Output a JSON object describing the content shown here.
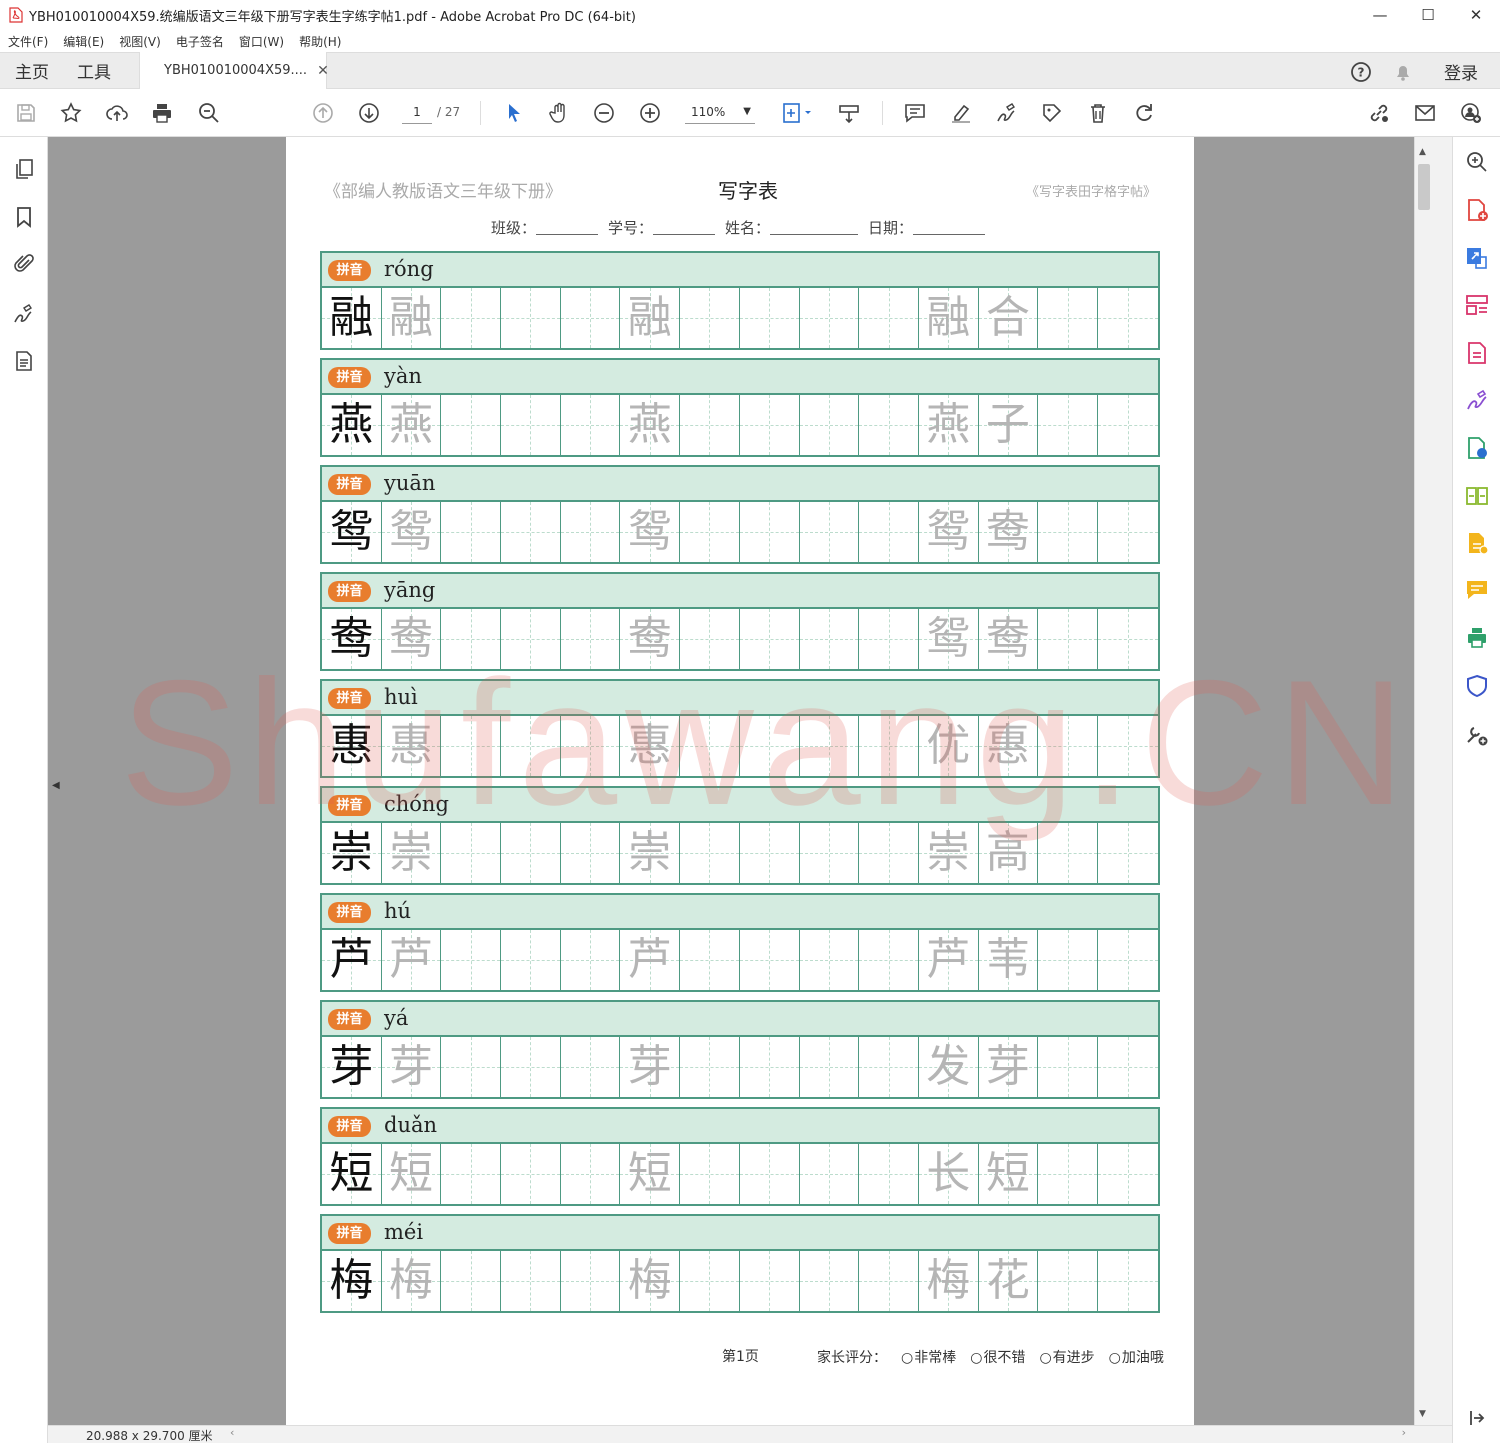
{
  "window": {
    "title": "YBH010010004X59.统编版语文三年级下册写字表生字练字帖1.pdf - Adobe Acrobat Pro DC (64-bit)",
    "minimize": "—",
    "maximize": "☐",
    "close": "✕"
  },
  "menu": [
    "文件(F)",
    "编辑(E)",
    "视图(V)",
    "电子签名",
    "窗口(W)",
    "帮助(H)"
  ],
  "tabs": {
    "home": "主页",
    "tools": "工具",
    "doc": "YBH010010004X59....",
    "doc_close": "✕",
    "login": "登录"
  },
  "toolbar": {
    "page_current": "1",
    "page_total": "/ 27",
    "zoom": "110%"
  },
  "page": {
    "header_left": "《部编人教版语文三年级下册》",
    "header_center": "写字表",
    "header_right": "《写字表田字格字帖》",
    "info": {
      "class_label": "班级：",
      "number_label": "学号：",
      "name_label": "姓名：",
      "date_label": "日期："
    },
    "badge": "拼音",
    "rows": [
      {
        "pinyin": "róng",
        "char": "融",
        "word": [
          "融",
          "合"
        ]
      },
      {
        "pinyin": "yàn",
        "char": "燕",
        "word": [
          "燕",
          "子"
        ]
      },
      {
        "pinyin": "yuān",
        "char": "鸳",
        "word": [
          "鸳",
          "鸯"
        ]
      },
      {
        "pinyin": "yāng",
        "char": "鸯",
        "word": [
          "鸳",
          "鸯"
        ]
      },
      {
        "pinyin": "huì",
        "char": "惠",
        "word": [
          "优",
          "惠"
        ]
      },
      {
        "pinyin": "chóng",
        "char": "崇",
        "word": [
          "崇",
          "高"
        ]
      },
      {
        "pinyin": "hú",
        "char": "芦",
        "word": [
          "芦",
          "苇"
        ]
      },
      {
        "pinyin": "yá",
        "char": "芽",
        "word": [
          "发",
          "芽"
        ]
      },
      {
        "pinyin": "duǎn",
        "char": "短",
        "word": [
          "长",
          "短"
        ]
      },
      {
        "pinyin": "méi",
        "char": "梅",
        "word": [
          "梅",
          "花"
        ]
      }
    ],
    "footer_page": "第1页",
    "rating_label": "家长评分：",
    "rating_options": [
      "非常棒",
      "很不错",
      "有进步",
      "加油哦"
    ]
  },
  "watermark": "Shufawang.CN",
  "status": {
    "page_size": "20.988 x 29.700 厘米"
  },
  "colors": {
    "grid_green": "#4e9a83",
    "header_fill": "#d4ebe0",
    "badge_orange": "#e87d2e",
    "trace_grey": "#b5b5b5"
  }
}
